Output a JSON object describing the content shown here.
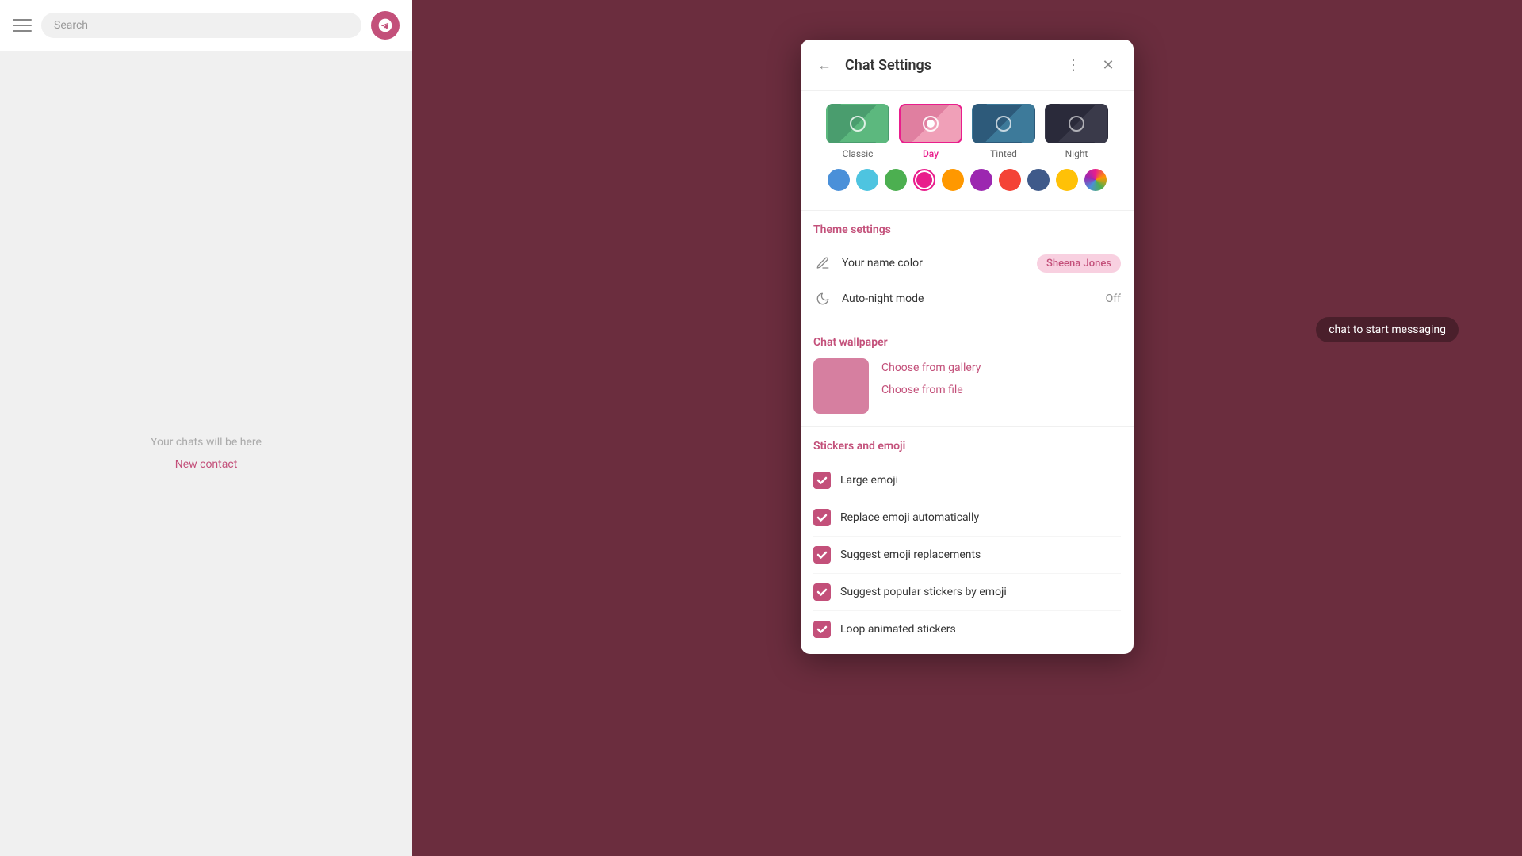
{
  "window": {
    "title": "Chat Settings",
    "minimize_label": "─",
    "maximize_label": "❐",
    "close_label": "✕"
  },
  "sidebar": {
    "search_placeholder": "Search",
    "empty_text": "Your chats will be here",
    "new_contact_label": "New contact"
  },
  "main": {
    "hint_text": "chat to start messaging"
  },
  "dialog": {
    "title": "Chat Settings",
    "back_icon": "←",
    "more_icon": "⋮",
    "close_icon": "✕",
    "theme_section": {
      "options": [
        {
          "id": "classic",
          "label": "Classic",
          "selected": false,
          "bg": "#4a9d6e"
        },
        {
          "id": "day",
          "label": "Day",
          "selected": true,
          "bg": "#e07fa0"
        },
        {
          "id": "tinted",
          "label": "Tinted",
          "selected": false,
          "bg": "#2d5a7a"
        },
        {
          "id": "night",
          "label": "Night",
          "selected": false,
          "bg": "#2a2a3a"
        }
      ],
      "colors": [
        {
          "id": "blue",
          "hex": "#4a90d9",
          "selected": false
        },
        {
          "id": "cyan",
          "hex": "#4ec4e0",
          "selected": false
        },
        {
          "id": "green",
          "hex": "#4caf50",
          "selected": false
        },
        {
          "id": "pink",
          "hex": "#e91e8c",
          "selected": true
        },
        {
          "id": "orange",
          "hex": "#ff9800",
          "selected": false
        },
        {
          "id": "purple",
          "hex": "#9c27b0",
          "selected": false
        },
        {
          "id": "red",
          "hex": "#f44336",
          "selected": false
        },
        {
          "id": "navy",
          "hex": "#3f5a8a",
          "selected": false
        },
        {
          "id": "yellow",
          "hex": "#ffc107",
          "selected": false
        },
        {
          "id": "multi",
          "hex": "multi",
          "selected": false
        }
      ]
    },
    "theme_settings": {
      "title": "Theme settings",
      "name_color_label": "Your name color",
      "name_color_value": "Sheena Jones",
      "auto_night_label": "Auto-night mode",
      "auto_night_value": "Off"
    },
    "chat_wallpaper": {
      "title": "Chat wallpaper",
      "choose_gallery_label": "Choose from gallery",
      "choose_file_label": "Choose from file"
    },
    "stickers_emoji": {
      "title": "Stickers and emoji",
      "items": [
        {
          "id": "large-emoji",
          "label": "Large emoji",
          "checked": true
        },
        {
          "id": "replace-emoji",
          "label": "Replace emoji automatically",
          "checked": true
        },
        {
          "id": "suggest-replacements",
          "label": "Suggest emoji replacements",
          "checked": true
        },
        {
          "id": "suggest-stickers",
          "label": "Suggest popular stickers by emoji",
          "checked": true
        },
        {
          "id": "loop-stickers",
          "label": "Loop animated stickers",
          "checked": true
        }
      ]
    }
  }
}
